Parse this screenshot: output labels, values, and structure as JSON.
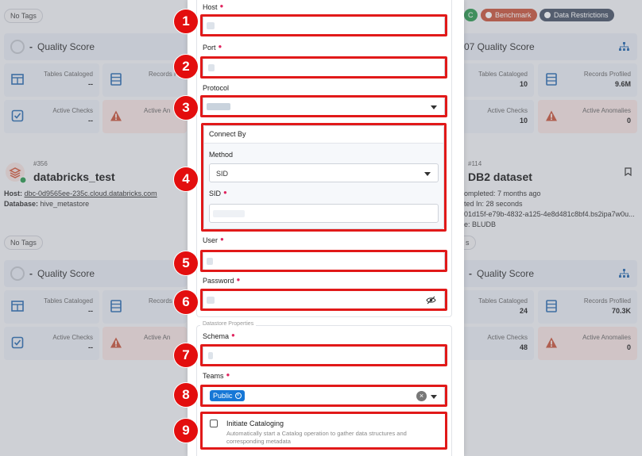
{
  "background": {
    "left_top": {
      "tag": "No Tags",
      "quality_label": "Quality Score",
      "quality_dash": "-",
      "stats": [
        {
          "label": "Tables Cataloged",
          "value": "--"
        },
        {
          "label": "Records Pr",
          "value": "--"
        },
        {
          "label": "Active Checks",
          "value": "--"
        },
        {
          "label": "Active An",
          "value": ""
        }
      ]
    },
    "right_top": {
      "badges": [
        "C",
        "Benchmark",
        "Data Restrictions"
      ],
      "quality_label": "07  Quality Score",
      "stats": [
        {
          "label": "Tables Cataloged",
          "value": "10"
        },
        {
          "label": "Records Profiled",
          "value": "9.6M"
        },
        {
          "label": "Active Checks",
          "value": "10"
        },
        {
          "label": "Active Anomalies",
          "value": "0"
        }
      ]
    },
    "left_bottom": {
      "id": "#356",
      "title": "databricks_test",
      "host_label": "Host:",
      "host": "dbc-0d9565ee-235c.cloud.databricks.com",
      "database_label": "Database:",
      "database": "hive_metastore",
      "tag": "No Tags",
      "quality_label": "Quality Score",
      "quality_dash": "-",
      "stats": [
        {
          "label": "Tables Cataloged",
          "value": "--"
        },
        {
          "label": "Records Pr",
          "value": "--"
        },
        {
          "label": "Active Checks",
          "value": "--"
        },
        {
          "label": "Active An",
          "value": ""
        }
      ]
    },
    "right_bottom": {
      "id": "#114",
      "title": "DB2 dataset",
      "line1": "ompleted: 7 months ago",
      "line2": "ted In: 28 seconds",
      "line3": "01d15f-e79b-4832-a125-4e8d481c8bf4.bs2ipa7w0u...",
      "line4": "e: BLUDB",
      "tag": "s",
      "quality_label": "Quality Score",
      "quality_dash": "-",
      "stats": [
        {
          "label": "Tables Cataloged",
          "value": "24"
        },
        {
          "label": "Records Profiled",
          "value": "70.3K"
        },
        {
          "label": "Active Checks",
          "value": "48"
        },
        {
          "label": "Active Anomalies",
          "value": "0"
        }
      ]
    }
  },
  "form": {
    "host_label": "Host",
    "port_label": "Port",
    "protocol_label": "Protocol",
    "connect_by_label": "Connect By",
    "method_label": "Method",
    "method_value": "SID",
    "sid_label": "SID",
    "user_label": "User",
    "password_label": "Password",
    "datastore_properties_legend": "Datastore Properties",
    "schema_label": "Schema",
    "teams_label": "Teams",
    "team_chip": "Public",
    "initiate_cataloging_label": "Initiate Cataloging",
    "initiate_cataloging_desc": "Automatically start a Catalog operation to gather data structures and corresponding metadata"
  },
  "markers": [
    "1",
    "2",
    "3",
    "4",
    "5",
    "6",
    "7",
    "8",
    "9"
  ],
  "colors": {
    "marker_red": "#e30e0e",
    "chip_blue": "#1677d6",
    "required": "#e0245e"
  }
}
